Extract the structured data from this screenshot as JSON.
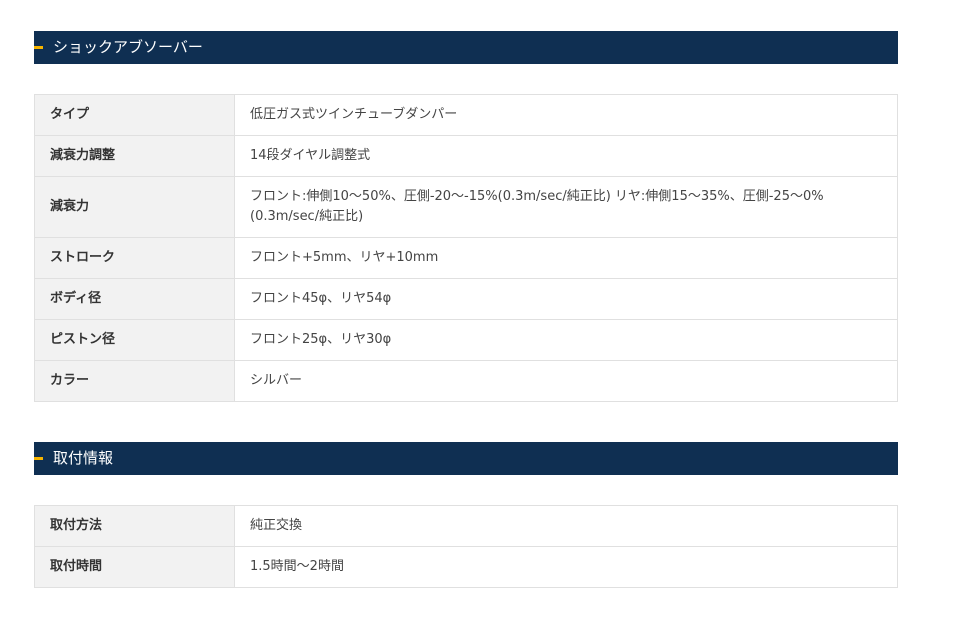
{
  "sections": [
    {
      "title": "ショックアブソーバー",
      "rows": [
        {
          "label": "タイプ",
          "value": "低圧ガス式ツインチューブダンパー"
        },
        {
          "label": "減衰力調整",
          "value": "14段ダイヤル調整式"
        },
        {
          "label": "減衰力",
          "value": "フロント:伸側10～50%、圧側-20～-15%(0.3m/sec/純正比) リヤ:伸側15～35%、圧側-25～0%(0.3m/sec/純正比)"
        },
        {
          "label": "ストローク",
          "value": "フロント+5mm、リヤ+10mm"
        },
        {
          "label": "ボディ径",
          "value": "フロント45φ、リヤ54φ"
        },
        {
          "label": "ピストン径",
          "value": "フロント25φ、リヤ30φ"
        },
        {
          "label": "カラー",
          "value": "シルバー"
        }
      ]
    },
    {
      "title": "取付情報",
      "rows": [
        {
          "label": "取付方法",
          "value": "純正交換"
        },
        {
          "label": "取付時間",
          "value": "1.5時間～2時間"
        }
      ]
    }
  ],
  "colors": {
    "header_bg": "#0f2f52",
    "header_accent": "#f5b400",
    "label_bg": "#f2f2f2",
    "border": "#e0e0e0"
  }
}
